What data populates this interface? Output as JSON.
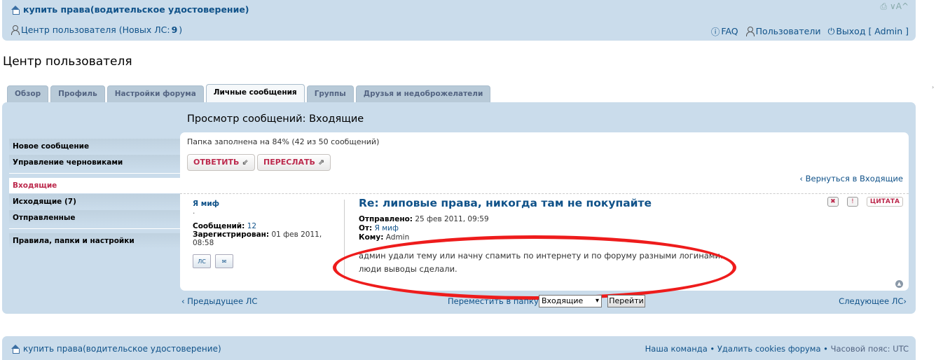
{
  "header": {
    "breadcrumb": "купить права(водительское удостоверение)",
    "top_icons": "⎙ ∨A^",
    "ucp_label": "Центр пользователя (Новых ЛС: ",
    "new_pm_count": "9",
    "ucp_close": ")",
    "faq": "FAQ",
    "members": "Пользователи",
    "logout": "Выход [ Admin ]"
  },
  "page_title": "Центр пользователя",
  "tabs": [
    "Обзор",
    "Профиль",
    "Настройки форума",
    "Личные сообщения",
    "Группы",
    "Друзья и недоброжелатели"
  ],
  "view_title": "Просмотр сообщений: Входящие",
  "sidebar": {
    "items": [
      "Новое сообщение",
      "Управление черновиками",
      "Входящие",
      "Исходящие (7)",
      "Отправленные",
      "Правила, папки и настройки"
    ]
  },
  "content": {
    "folder_status": "Папка заполнена на 84% (42 из 50 сообщений)",
    "reply_btn": "ОТВЕТИТЬ",
    "forward_btn": "ПЕРЕСЛАТЬ",
    "return_link": "Вернуться в Входящие"
  },
  "author": {
    "name": "Я миф",
    "dot": "·",
    "posts_label": "Сообщений:",
    "posts_value": "12",
    "registered_label": "Зарегистрирован:",
    "registered_value": "01 фев 2011, 08:58",
    "pm_icon": "ЛС",
    "email_icon": "✉"
  },
  "post": {
    "title": "Re: липовые права, никогда там не покупайте",
    "sent_label": "Отправлено:",
    "sent_value": "25 фев 2011, 09:59",
    "from_label": "От:",
    "from_value": "Я миф",
    "to_label": "Кому:",
    "to_value": "Admin",
    "line1": "админ удали тему или начну спамить по интернету и по форуму разными логинами.",
    "line2": "люди выводы сделали.",
    "quote_btn": "ЦИТАТА",
    "delete_icon": "✖",
    "report_icon": "!"
  },
  "pager": {
    "prev": "Предыдущее ЛС",
    "next": "Следующее ЛС",
    "move_label": "Переместить в папку:",
    "folder_select": "Входящие",
    "go_btn": "Перейти"
  },
  "footer": {
    "breadcrumb": "купить права(водительское удостоверение)",
    "team": "Наша команда",
    "delete_cookies": "Удалить cookies форума",
    "timezone": "Часовой пояс: UTC"
  },
  "colors": {
    "panel": "#cadceb",
    "link": "#105289",
    "accent": "#bc2a4d",
    "annotation": "#ee1c1c"
  }
}
